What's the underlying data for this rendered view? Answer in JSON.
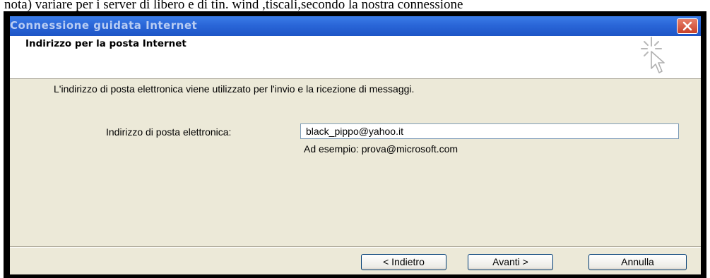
{
  "document": {
    "text_above": "nota) variare per i server di libero e di tin. wind ,tiscali,secondo la nostra connessione"
  },
  "window": {
    "title": "Connessione guidata Internet",
    "close_icon": "close-icon"
  },
  "header": {
    "title": "Indirizzo per la posta Internet",
    "icon": "wizard-sparkle-icon"
  },
  "body": {
    "description": "L'indirizzo di posta elettronica viene utilizzato per l'invio e la ricezione di messaggi.",
    "email_label": "Indirizzo di posta elettronica:",
    "email_value": "black_pippo@yahoo.it",
    "example": "Ad esempio: prova@microsoft.com"
  },
  "buttons": {
    "back": "< Indietro",
    "next": "Avanti >",
    "cancel": "Annulla"
  },
  "colors": {
    "title_bar": "#2a66d8",
    "title_text": "#b9cdf3",
    "dialog_bg": "#ece9d8",
    "close_button": "#c8412a"
  }
}
